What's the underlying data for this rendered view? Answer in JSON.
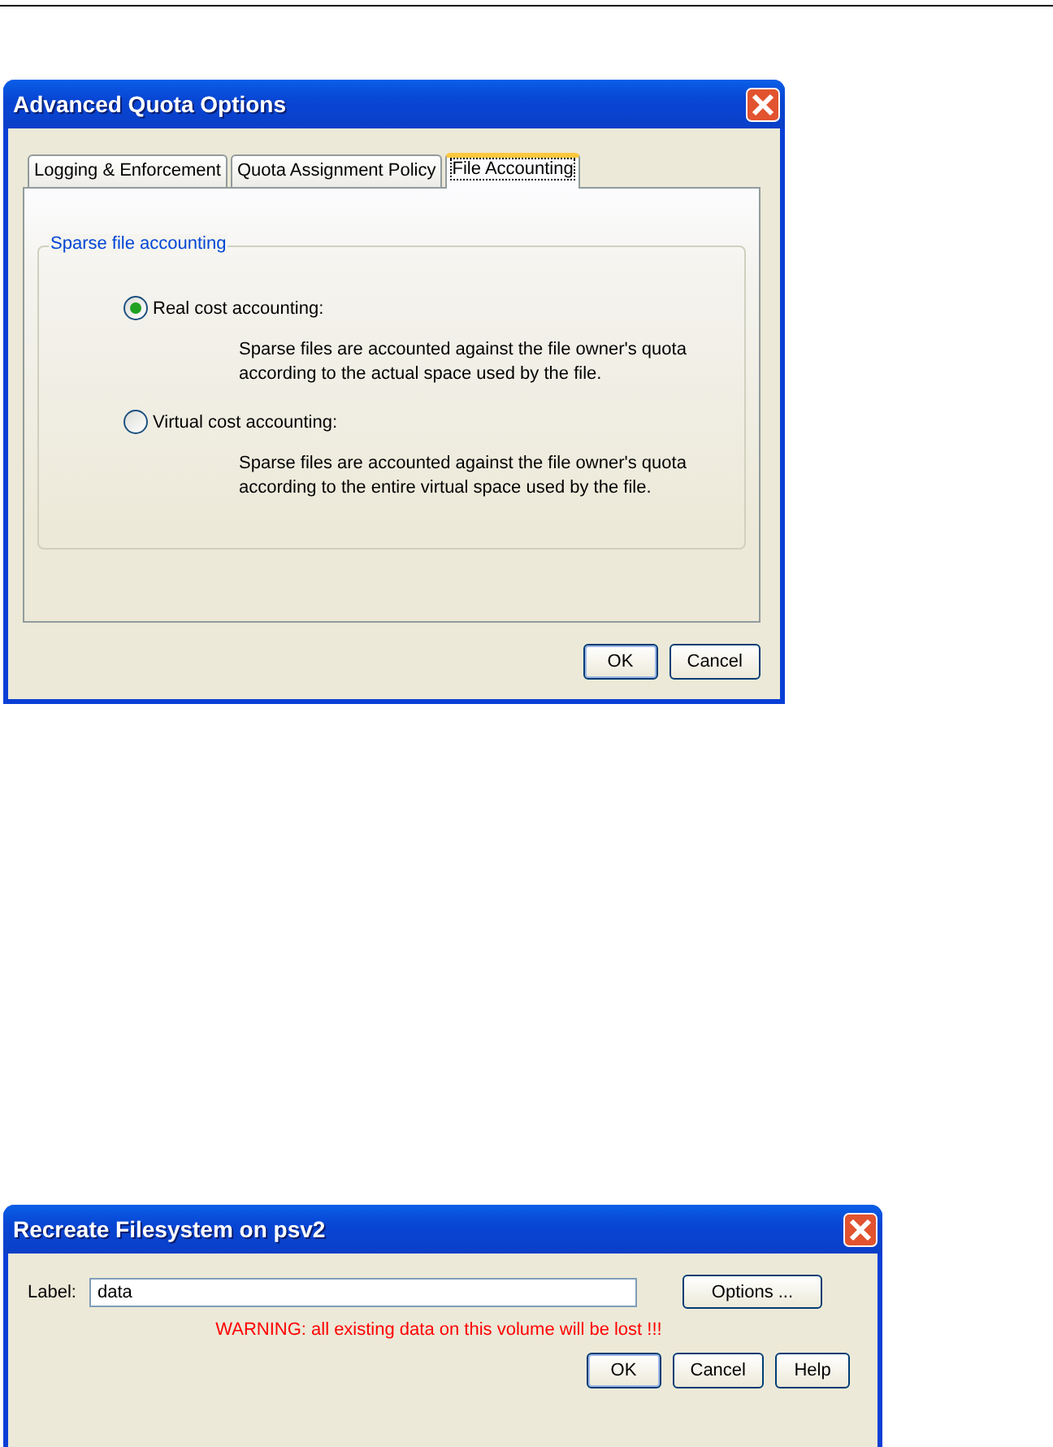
{
  "quota_dialog": {
    "title": "Advanced Quota Options",
    "tabs": [
      {
        "label": "Logging & Enforcement",
        "selected": false
      },
      {
        "label": "Quota Assignment Policy",
        "selected": false
      },
      {
        "label": "File Accounting",
        "selected": true
      }
    ],
    "group_title": "Sparse file accounting",
    "options": [
      {
        "label": "Real cost accounting:",
        "selected": true,
        "description": "Sparse files are accounted against the file owner's quota according to the actual space used by the file."
      },
      {
        "label": "Virtual cost accounting:",
        "selected": false,
        "description": "Sparse files are accounted against the file owner's quota according to the entire virtual space used by the file."
      }
    ],
    "buttons": [
      "OK",
      "Cancel"
    ]
  },
  "recreate_dialog": {
    "title": "Recreate Filesystem on psv2",
    "label": "Label:",
    "value": "data",
    "options_button": "Options ...",
    "warning": "WARNING: all existing data on this volume will be lost !!!",
    "buttons": [
      "OK",
      "Cancel",
      "Help"
    ]
  }
}
